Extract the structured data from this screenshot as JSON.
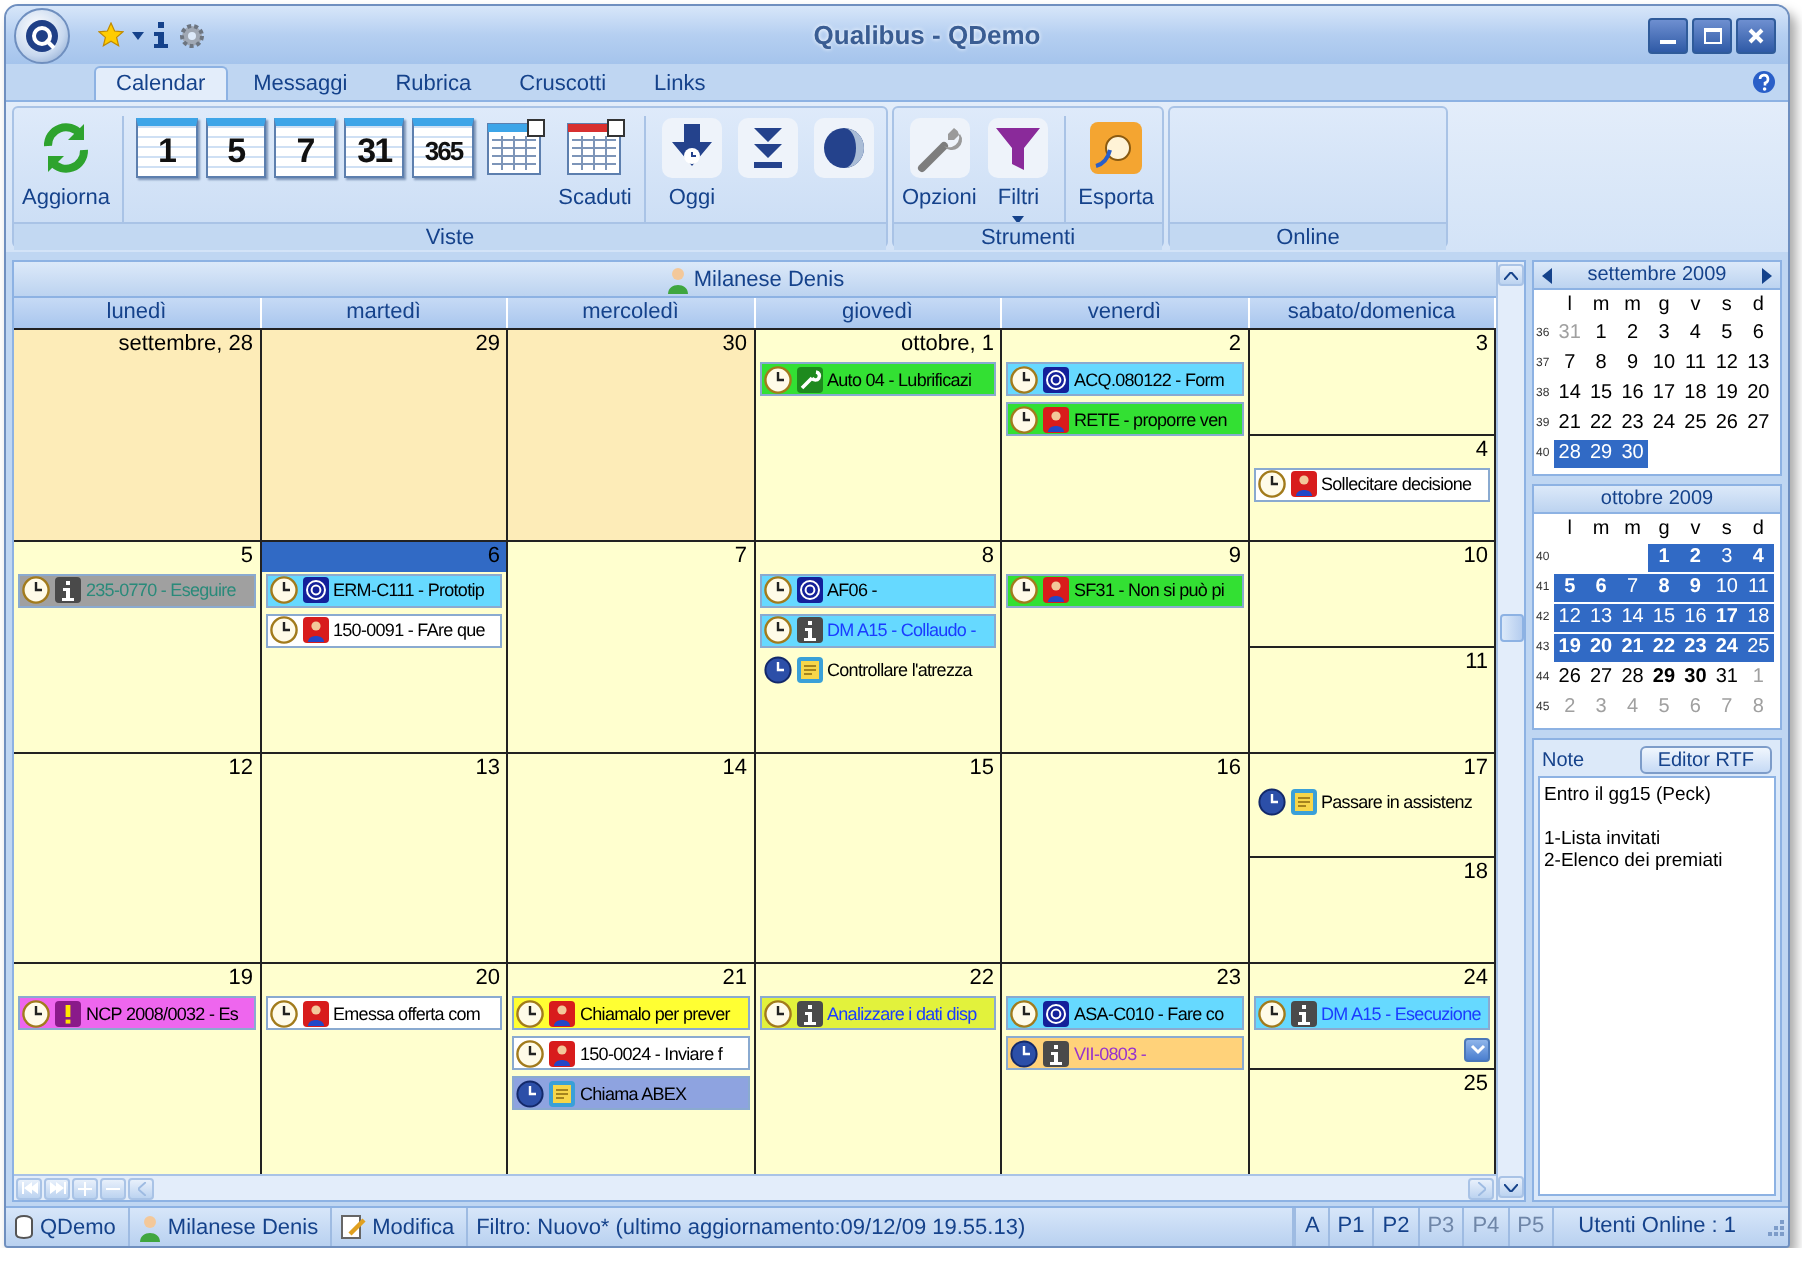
{
  "window": {
    "title": "Qualibus  -  QDemo"
  },
  "tabs": [
    {
      "label": "Calendar",
      "selected": true
    },
    {
      "label": "Messaggi",
      "selected": false
    },
    {
      "label": "Rubrica",
      "selected": false
    },
    {
      "label": "Cruscotti",
      "selected": false
    },
    {
      "label": "Links",
      "selected": false
    }
  ],
  "ribbon": [
    {
      "title": "Viste",
      "buttons": [
        {
          "kind": "refresh",
          "label": "Aggiorna"
        },
        {
          "kind": "separator"
        },
        {
          "kind": "number",
          "number": "1"
        },
        {
          "kind": "number",
          "number": "5"
        },
        {
          "kind": "number",
          "number": "7"
        },
        {
          "kind": "number",
          "number": "31"
        },
        {
          "kind": "number",
          "number": "365"
        },
        {
          "kind": "grid"
        },
        {
          "kind": "grid_red",
          "label": "Scaduti"
        },
        {
          "kind": "separator"
        },
        {
          "kind": "today",
          "label": "Oggi"
        },
        {
          "kind": "down"
        },
        {
          "kind": "moon"
        }
      ]
    },
    {
      "title": "Strumenti",
      "buttons": [
        {
          "kind": "wrench",
          "label": "Opzioni"
        },
        {
          "kind": "filter",
          "label": "Filtri",
          "dropdown": true
        },
        {
          "kind": "separator"
        },
        {
          "kind": "export",
          "label": "Esporta"
        }
      ]
    },
    {
      "title": "Online"
    }
  ],
  "calendar": {
    "person": "Milanese Denis",
    "day_names": [
      "lunedì",
      "martedì",
      "mercoledì",
      "giovedì",
      "venerdì",
      "sabato/domenica"
    ],
    "weeks": [
      {
        "days": [
          {
            "label": "settembre, 28",
            "past": true,
            "selected": false
          },
          {
            "label": "29",
            "past": true,
            "selected": false
          },
          {
            "label": "30",
            "past": true,
            "selected": false
          },
          {
            "label": "ottobre, 1",
            "selected": false,
            "events": [
              {
                "text": "Auto 04 - Lubrificazi",
                "kind": "clock_wrench",
                "color": "#33e033"
              }
            ]
          },
          {
            "label": "2",
            "selected": false,
            "events": [
              {
                "text": "ACQ.080122 - Form",
                "kind": "clock_spiral",
                "color": "#66d9ff"
              },
              {
                "text": "RETE - proporre ven",
                "kind": "clock_person",
                "color": "#33e033"
              }
            ]
          },
          {
            "label": "3",
            "selected": false
          },
          {
            "label": "4",
            "selected": false,
            "events": [
              {
                "text": "Sollecitare decisione",
                "kind": "clock_person",
                "color": "#ffffff"
              }
            ]
          }
        ]
      },
      {
        "days": [
          {
            "label": "5",
            "selected": false,
            "events": [
              {
                "text": "235-0770 - Eseguire",
                "kind": "clock_info",
                "color": "#a0a0a0"
              }
            ]
          },
          {
            "label": "6",
            "selected": true,
            "events": [
              {
                "text": "ERM-C111 - Prototip",
                "kind": "clock_spiral",
                "color": "#66d9ff"
              },
              {
                "text": "150-0091 - FAre que",
                "kind": "clock_person",
                "color": "#ffffff"
              }
            ]
          },
          {
            "label": "7",
            "selected": false
          },
          {
            "label": "8",
            "selected": false,
            "events": [
              {
                "text": "AF06 -",
                "kind": "clock_spiral",
                "color": "#66d9ff"
              },
              {
                "text": "DM A15 - Collaudo -",
                "kind": "clock_info",
                "color": "#66d9ff"
              },
              {
                "text": "Controllare l'atrezza",
                "kind": "blueclock_note"
              }
            ]
          },
          {
            "label": "9",
            "selected": false,
            "events": [
              {
                "text": "SF31 - Non si può pi",
                "kind": "clock_person",
                "color": "#33e033"
              }
            ]
          },
          {
            "label": "10",
            "selected": false
          },
          {
            "label": "11",
            "selected": false
          }
        ]
      },
      {
        "days": [
          {
            "label": "12",
            "selected": false
          },
          {
            "label": "13",
            "selected": false
          },
          {
            "label": "14",
            "selected": false
          },
          {
            "label": "15",
            "selected": false
          },
          {
            "label": "16",
            "selected": false
          },
          {
            "label": "17",
            "selected": false,
            "events": [
              {
                "text": "Passare in assistenz",
                "kind": "blueclock_note"
              }
            ]
          },
          {
            "label": "18",
            "selected": false
          }
        ]
      },
      {
        "days": [
          {
            "label": "19",
            "selected": false,
            "events": [
              {
                "text": "NCP 2008/0032 - Es",
                "kind": "clock_alert",
                "color": "#ee66ee"
              }
            ]
          },
          {
            "label": "20",
            "selected": false,
            "events": [
              {
                "text": "Emessa offerta com",
                "kind": "clock_person",
                "color": "#ffffff"
              }
            ]
          },
          {
            "label": "21",
            "selected": false,
            "events": [
              {
                "text": "Chiamalo per prever",
                "kind": "clock_person",
                "color": "#ffff33"
              },
              {
                "text": "150-0024 - Inviare f",
                "kind": "clock_person",
                "color": "#ffffff"
              },
              {
                "text": "Chiama ABEX",
                "kind": "blueclock_note",
                "color": "#8ea3e0"
              }
            ]
          },
          {
            "label": "22",
            "selected": false,
            "events": [
              {
                "text": "Analizzare i dati disp",
                "kind": "clock_info",
                "color": "#e2f23c"
              }
            ]
          },
          {
            "label": "23",
            "selected": false,
            "events": [
              {
                "text": "ASA-C010 - Fare co",
                "kind": "clock_spiral",
                "color": "#66d9ff"
              },
              {
                "text": "VII-0803 -",
                "kind": "blueclock_info",
                "color": "#ffd27a"
              }
            ]
          },
          {
            "label": "24",
            "selected": false,
            "more": true,
            "events": [
              {
                "text": "DM A15 - Esecuzione",
                "kind": "clock_info",
                "color": "#66d9ff"
              }
            ]
          },
          {
            "label": "25",
            "selected": false
          }
        ]
      }
    ]
  },
  "mini_calendars": [
    {
      "title": "settembre 2009",
      "arrows": true,
      "weekdays": [
        "l",
        "m",
        "m",
        "g",
        "v",
        "s",
        "d"
      ],
      "weeks": [
        {
          "week": "36",
          "days": [
            {
              "n": "31",
              "muted": true
            },
            {
              "n": "1"
            },
            {
              "n": "2"
            },
            {
              "n": "3"
            },
            {
              "n": "4"
            },
            {
              "n": "5"
            },
            {
              "n": "6"
            }
          ]
        },
        {
          "week": "37",
          "days": [
            {
              "n": "7"
            },
            {
              "n": "8"
            },
            {
              "n": "9"
            },
            {
              "n": "10"
            },
            {
              "n": "11"
            },
            {
              "n": "12"
            },
            {
              "n": "13"
            }
          ]
        },
        {
          "week": "38",
          "days": [
            {
              "n": "14"
            },
            {
              "n": "15"
            },
            {
              "n": "16"
            },
            {
              "n": "17"
            },
            {
              "n": "18"
            },
            {
              "n": "19"
            },
            {
              "n": "20"
            }
          ]
        },
        {
          "week": "39",
          "days": [
            {
              "n": "21"
            },
            {
              "n": "22"
            },
            {
              "n": "23"
            },
            {
              "n": "24"
            },
            {
              "n": "25"
            },
            {
              "n": "26"
            },
            {
              "n": "27"
            }
          ]
        },
        {
          "week": "40",
          "days": [
            {
              "n": "28",
              "selected": true
            },
            {
              "n": "29",
              "selected": true
            },
            {
              "n": "30",
              "selected": true
            }
          ]
        }
      ]
    },
    {
      "title": "ottobre 2009",
      "weekdays": [
        "l",
        "m",
        "m",
        "g",
        "v",
        "s",
        "d"
      ],
      "weeks": [
        {
          "week": "40",
          "days": [
            {
              "n": "1",
              "selected": true,
              "bold": true
            },
            {
              "n": "2",
              "selected": true,
              "bold": true
            },
            {
              "n": "3",
              "selected": true
            },
            {
              "n": "4",
              "selected": true,
              "bold": true
            }
          ]
        },
        {
          "week": "41",
          "days": [
            {
              "n": "5",
              "selected": true,
              "bold": true
            },
            {
              "n": "6",
              "selected": true,
              "bold": true
            },
            {
              "n": "7",
              "selected": true
            },
            {
              "n": "8",
              "selected": true,
              "bold": true
            },
            {
              "n": "9",
              "selected": true,
              "bold": true
            },
            {
              "n": "10",
              "selected": true
            },
            {
              "n": "11",
              "selected": true
            }
          ]
        },
        {
          "week": "42",
          "days": [
            {
              "n": "12",
              "selected": true
            },
            {
              "n": "13",
              "selected": true
            },
            {
              "n": "14",
              "selected": true
            },
            {
              "n": "15",
              "selected": true
            },
            {
              "n": "16",
              "selected": true
            },
            {
              "n": "17",
              "selected": true,
              "bold": true
            },
            {
              "n": "18",
              "selected": true
            }
          ]
        },
        {
          "week": "43",
          "days": [
            {
              "n": "19",
              "selected": true,
              "bold": true
            },
            {
              "n": "20",
              "selected": true,
              "bold": true
            },
            {
              "n": "21",
              "selected": true,
              "bold": true
            },
            {
              "n": "22",
              "selected": true,
              "bold": true
            },
            {
              "n": "23",
              "selected": true,
              "bold": true
            },
            {
              "n": "24",
              "selected": true,
              "bold": true
            },
            {
              "n": "25",
              "selected": true
            }
          ]
        },
        {
          "week": "44",
          "days": [
            {
              "n": "26"
            },
            {
              "n": "27"
            },
            {
              "n": "28"
            },
            {
              "n": "29",
              "bold": true
            },
            {
              "n": "30",
              "bold": true
            },
            {
              "n": "31"
            },
            {
              "n": "1",
              "muted": true
            }
          ]
        },
        {
          "week": "45",
          "days": [
            {
              "n": "2",
              "muted": true
            },
            {
              "n": "3",
              "muted": true
            },
            {
              "n": "4",
              "muted": true
            },
            {
              "n": "5",
              "muted": true
            },
            {
              "n": "6",
              "muted": true
            },
            {
              "n": "7",
              "muted": true
            },
            {
              "n": "8",
              "muted": true
            }
          ]
        }
      ]
    }
  ],
  "notes": {
    "title": "Note",
    "button": "Editor RTF",
    "paragraphs": [
      [
        "Entro il gg15 (Peck)"
      ],
      [
        "1-Lista invitati",
        "2-Elenco dei premiati"
      ]
    ]
  },
  "status_bar": {
    "items": [
      {
        "kind": "database",
        "text": "QDemo"
      },
      {
        "kind": "person",
        "text": "Milanese Denis"
      },
      {
        "kind": "edit",
        "text": "Modifica"
      }
    ],
    "filter": "Filtro: Nuovo*  (ultimo aggiornamento:09/12/09 19.55.13)",
    "priorities": [
      {
        "label": "A",
        "disabled": false
      },
      {
        "label": "P1",
        "disabled": false
      },
      {
        "label": "P2",
        "disabled": false
      },
      {
        "label": "P3",
        "disabled": true
      },
      {
        "label": "P4",
        "disabled": true
      },
      {
        "label": "P5",
        "disabled": true
      }
    ],
    "online": "Utenti Online : 1"
  }
}
